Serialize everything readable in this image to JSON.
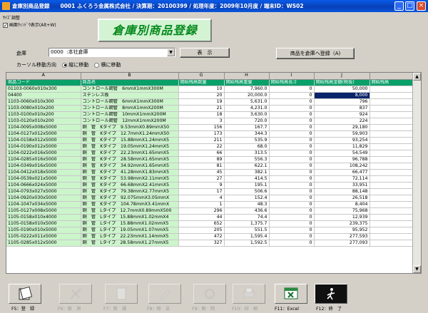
{
  "titlebar": {
    "text": "倉庫別商品登録　　0001 ふくろう金属株式会社 / 決算期：20100399 / 処理年度：2009年10月度 / 端末ID：WS02",
    "minimize": "_",
    "maximize": "□",
    "close": "×"
  },
  "size_adjust": {
    "heading": "ｻｲｽﾞ調整",
    "checkbox_label": "画面ｳｨﾝﾄﾞｳ表示(Alt+W)",
    "checked": true
  },
  "page_title": "倉庫別商品登録",
  "warehouse": {
    "label": "倉庫",
    "code": "0000",
    "name": ":本社倉庫"
  },
  "buttons": {
    "display": "表　示",
    "register": "商品を倉庫へ登録（A)"
  },
  "cursor_direction": {
    "label": "カーソル移動方向",
    "options": [
      "縦に移動",
      "横に移動"
    ],
    "selected": "縦に移動"
  },
  "grid": {
    "column_letters": [
      "A",
      "B",
      "G",
      "H",
      "I",
      "J"
    ],
    "headers": [
      "商品コード",
      "商品名",
      "開始残高数量",
      "開始残高重量",
      "開始残高長さ",
      "開始残高金額(税抜)",
      "開始残高"
    ],
    "rows": [
      [
        "01103-0060x010x300",
        "コントロール鋼管　6mmX1mmX300M",
        "10",
        "7,960.0",
        "0",
        "50,000"
      ],
      [
        "04400",
        "ステンレス板",
        "20",
        "20,000.0",
        "0",
        "8,000"
      ],
      [
        "1103-0060x010x300",
        "コントロール鋼管　6mmX1mmX300M",
        "19",
        "5,631.0",
        "0",
        "796"
      ],
      [
        "1103-0080x010x200",
        "コントロール鋼管　8mmX1mmX200M",
        "21",
        "4,231.0",
        "0",
        "837"
      ],
      [
        "1103-0100x010x200",
        "コントロール鋼管　10mmX1mmX200M",
        "18",
        "3,630.0",
        "0",
        "924"
      ],
      [
        "1103-0120x010x200",
        "コントロール鋼管　12mmX1mmX200M",
        "3",
        "720.0",
        "0",
        "224"
      ],
      [
        "1104-0095x008x5000",
        "銅　管　Kタイプ　9.53mmX0.89mmX50",
        "156",
        "167.7",
        "0",
        "29,180"
      ],
      [
        "1104-0127x012x5000",
        "銅　管　Kタイプ　12.7mmX1.24mmX50",
        "173",
        "344.3",
        "0",
        "59,903"
      ],
      [
        "1104-0158x012x5000",
        "銅　管　Kタイプ　15.88mmX1.24mmX5",
        "211",
        "535.9",
        "0",
        "93,254"
      ],
      [
        "1104-0190x012x5000",
        "銅　管　Kタイプ　19.05mmX1.24mmX5",
        "22",
        "68.0",
        "0",
        "11,829"
      ],
      [
        "1104-0222x016x5000",
        "銅　管　Kタイプ　22.23mmX1.65mmX5",
        "66",
        "313.5",
        "0",
        "54,549"
      ],
      [
        "1104-0285x016x5000",
        "銅　管　Kタイプ　28.58mmX1.65mmX5",
        "89",
        "556.3",
        "0",
        "96,788"
      ],
      [
        "1104-0349x016x5000",
        "銅　管　Kタイプ　34.92mmX1.65mmX5",
        "81",
        "622.1",
        "0",
        "108,242"
      ],
      [
        "1104-0412x018x5000",
        "銅　管　Kタイプ　41.28mmX1.83mmX5",
        "45",
        "382.1",
        "0",
        "66,477"
      ],
      [
        "1104-0539x021x5000",
        "銅　管　Kタイプ　53.98mmX2.11mmX5",
        "27",
        "414.5",
        "0",
        "72,114"
      ],
      [
        "1104-0666x024x5000",
        "銅　管　Kタイプ　66.68mmX2.41mmX5",
        "9",
        "195.1",
        "0",
        "33,951"
      ],
      [
        "1104-0793x027x5000",
        "銅　管　Kタイプ　79.38mmX2.77mmX5",
        "17",
        "506.6",
        "0",
        "88,148"
      ],
      [
        "1104-0920x030x5000",
        "銅　管　Kタイプ　92.075mmX3.05mmX",
        "4",
        "152.4",
        "0",
        "26,518"
      ],
      [
        "1104-1047x034x5000",
        "銅　管　Kタイプ　104.78mmX3.41mmX",
        "1",
        "48.3",
        "0",
        "8,404"
      ],
      [
        "1105-0127x008x5000",
        "銅　管　Lタイプ　12.7mmX0.89mmX500",
        "296",
        "436.6",
        "0",
        "75,968"
      ],
      [
        "1105-0158x010x4000",
        "銅　管　Lタイプ　15.88mmX1.02mmX4",
        "44",
        "74.4",
        "0",
        "12,939"
      ],
      [
        "1105-0158x010x5000",
        "銅　管　Lタイプ　15.88mmX1.02mmX5",
        "652",
        "1,375.7",
        "0",
        "239,375"
      ],
      [
        "1105-0190x010x5000",
        "銅　管　Lタイプ　19.05mmX1.07mmX5",
        "205",
        "551.5",
        "0",
        "95,952"
      ],
      [
        "1105-0222x011x5000",
        "銅　管　Lタイプ　22.23mmX1.14mmX5",
        "472",
        "1,595.4",
        "0",
        "277,593"
      ],
      [
        "1105-0285x012x5000",
        "銅　管　Lタイプ　28.58mmX1.27mmX5",
        "327",
        "1,592.5",
        "0",
        "277,093"
      ]
    ]
  },
  "function_keys": [
    {
      "label": "F5：登　録",
      "icon": "register-book-icon",
      "enabled": true
    },
    {
      "label": "F6：取　消",
      "icon": "cancel-icon",
      "enabled": false
    },
    {
      "label": "F7：新　規",
      "icon": "new-document-icon",
      "enabled": false
    },
    {
      "label": "F8：修　正",
      "icon": "edit-icon",
      "enabled": false
    },
    {
      "label": "F9：削　除",
      "icon": "delete-icon",
      "enabled": false
    },
    {
      "label": "F10：印　刷",
      "icon": "print-icon",
      "enabled": false
    },
    {
      "label": "F11：Excel",
      "icon": "excel-icon",
      "enabled": true
    },
    {
      "label": "F12：終　了",
      "icon": "exit-icon",
      "enabled": true
    }
  ],
  "colors": {
    "title_green": "#058a1c",
    "header_green": "#0aa06a",
    "code_cell_green": "#ccf5cc",
    "selection": "#0a246a"
  }
}
